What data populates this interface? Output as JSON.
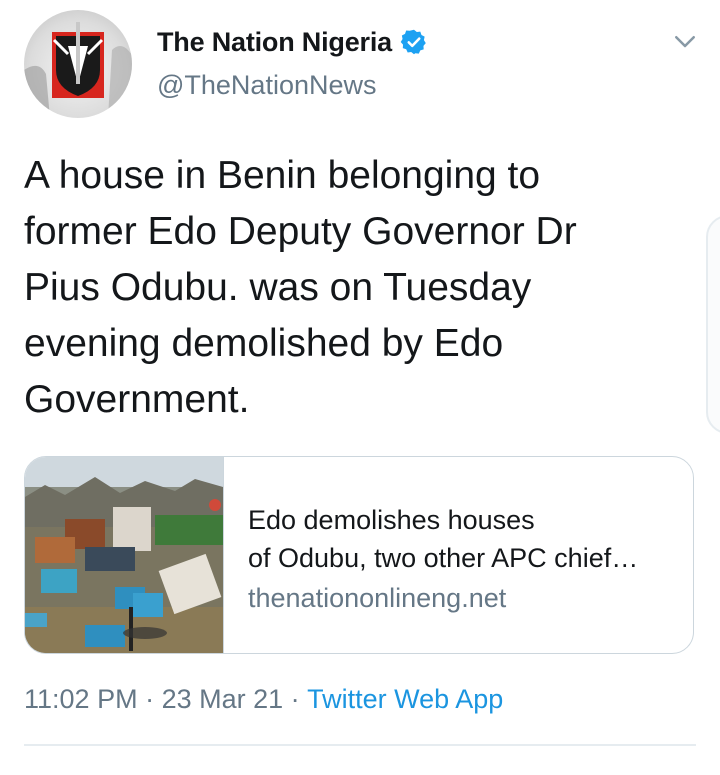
{
  "account": {
    "display_name": "The Nation Nigeria",
    "handle": "@TheNationNews",
    "verified": true
  },
  "tweet": {
    "text": "A house in Benin belonging to\nformer Edo Deputy Governor Dr\nPius Odubu. was on Tuesday\nevening demolished by Edo\nGovernment."
  },
  "link_card": {
    "title": "Edo demolishes houses\nof Odubu, two other APC chief…",
    "domain": "thenationonlineng.net"
  },
  "meta": {
    "time": "11:02 PM",
    "separator": " · ",
    "date": "23 Mar 21",
    "source": "Twitter Web App"
  },
  "colors": {
    "accent": "#1b95e0",
    "secondary_text": "#657786",
    "border": "#ccd6dd",
    "logo_red": "#d7261e"
  },
  "icons": {
    "verified": "verified-badge-icon",
    "more": "chevron-down-icon"
  }
}
